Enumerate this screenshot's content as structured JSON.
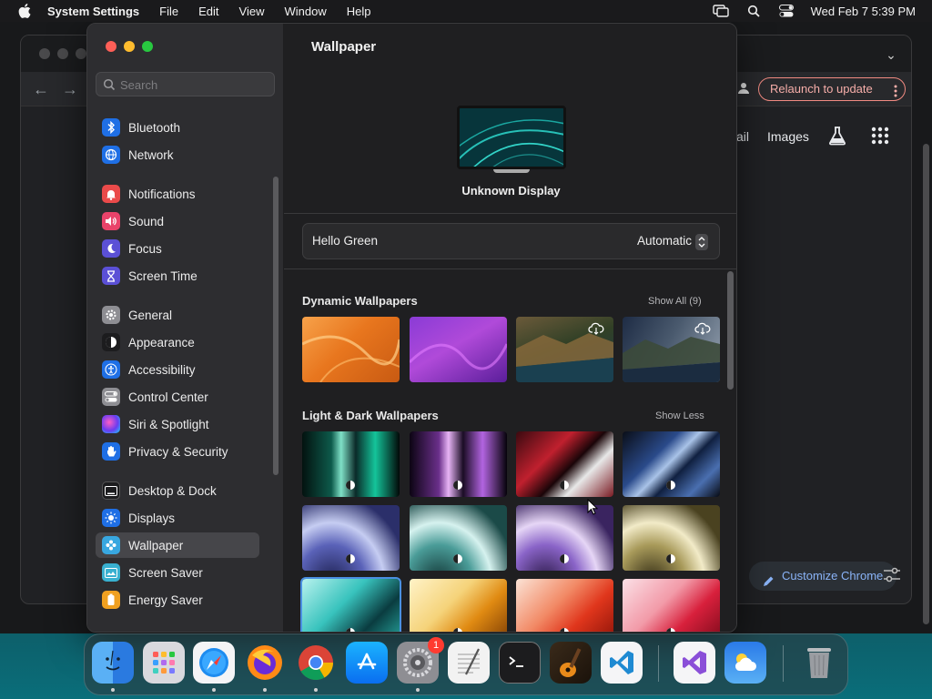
{
  "menubar": {
    "app_name": "System Settings",
    "menus": [
      "File",
      "Edit",
      "View",
      "Window",
      "Help"
    ],
    "clock": "Wed Feb 7  5:39 PM",
    "icons": [
      "apple-icon",
      "screen-mirroring-icon",
      "spotlight-search-icon",
      "control-center-icon"
    ]
  },
  "chrome": {
    "relaunch_label": "Relaunch to update",
    "links": [
      "ail",
      "Images"
    ],
    "customize_label": "Customize Chrome",
    "accent": "#f28b82"
  },
  "settings": {
    "search_placeholder": "Search",
    "sidebar": {
      "groups": [
        [
          {
            "label": "Bluetooth",
            "icon": "bluetooth-icon",
            "color": "#1f6fe5"
          },
          {
            "label": "Network",
            "icon": "globe-icon",
            "color": "#1f6fe5"
          }
        ],
        [
          {
            "label": "Notifications",
            "icon": "bell-icon",
            "color": "#ea4a4a"
          },
          {
            "label": "Sound",
            "icon": "speaker-icon",
            "color": "#e9436a"
          },
          {
            "label": "Focus",
            "icon": "moon-icon",
            "color": "#5b50d6"
          },
          {
            "label": "Screen Time",
            "icon": "hourglass-icon",
            "color": "#5b50d6"
          }
        ],
        [
          {
            "label": "General",
            "icon": "gear-icon",
            "color": "#8e8e93"
          },
          {
            "label": "Appearance",
            "icon": "appearance-icon",
            "color": "#1c1c1e"
          },
          {
            "label": "Accessibility",
            "icon": "accessibility-icon",
            "color": "#1f6fe5"
          },
          {
            "label": "Control Center",
            "icon": "control-center-icon",
            "color": "#8e8e93"
          },
          {
            "label": "Siri & Spotlight",
            "icon": "siri-icon",
            "color": "#3a1f6a"
          },
          {
            "label": "Privacy & Security",
            "icon": "hand-icon",
            "color": "#1f6fe5"
          }
        ],
        [
          {
            "label": "Desktop & Dock",
            "icon": "dock-icon",
            "color": "#1c1c1e"
          },
          {
            "label": "Displays",
            "icon": "sun-icon",
            "color": "#1f6fe5"
          },
          {
            "label": "Wallpaper",
            "icon": "wallpaper-icon",
            "color": "#38a7e0",
            "selected": true
          },
          {
            "label": "Screen Saver",
            "icon": "screen-saver-icon",
            "color": "#38b0d0"
          },
          {
            "label": "Energy Saver",
            "icon": "battery-icon",
            "color": "#f0a020"
          }
        ]
      ]
    },
    "content": {
      "title": "Wallpaper",
      "display_name": "Unknown Display",
      "current_wallpaper": "Hello Green",
      "mode": "Automatic",
      "sections": [
        {
          "title": "Dynamic Wallpapers",
          "link": "Show All (9)"
        },
        {
          "title": "Light & Dark Wallpapers",
          "link": "Show Less"
        }
      ]
    }
  },
  "dock": {
    "apps": [
      "Finder",
      "Launchpad",
      "Safari",
      "Firefox",
      "Google Chrome",
      "App Store",
      "System Settings",
      "TextEdit",
      "Terminal",
      "GarageBand",
      "Visual Studio Code",
      "Visual Studio",
      "Weather",
      "Trash"
    ],
    "settings_badge": "1"
  }
}
